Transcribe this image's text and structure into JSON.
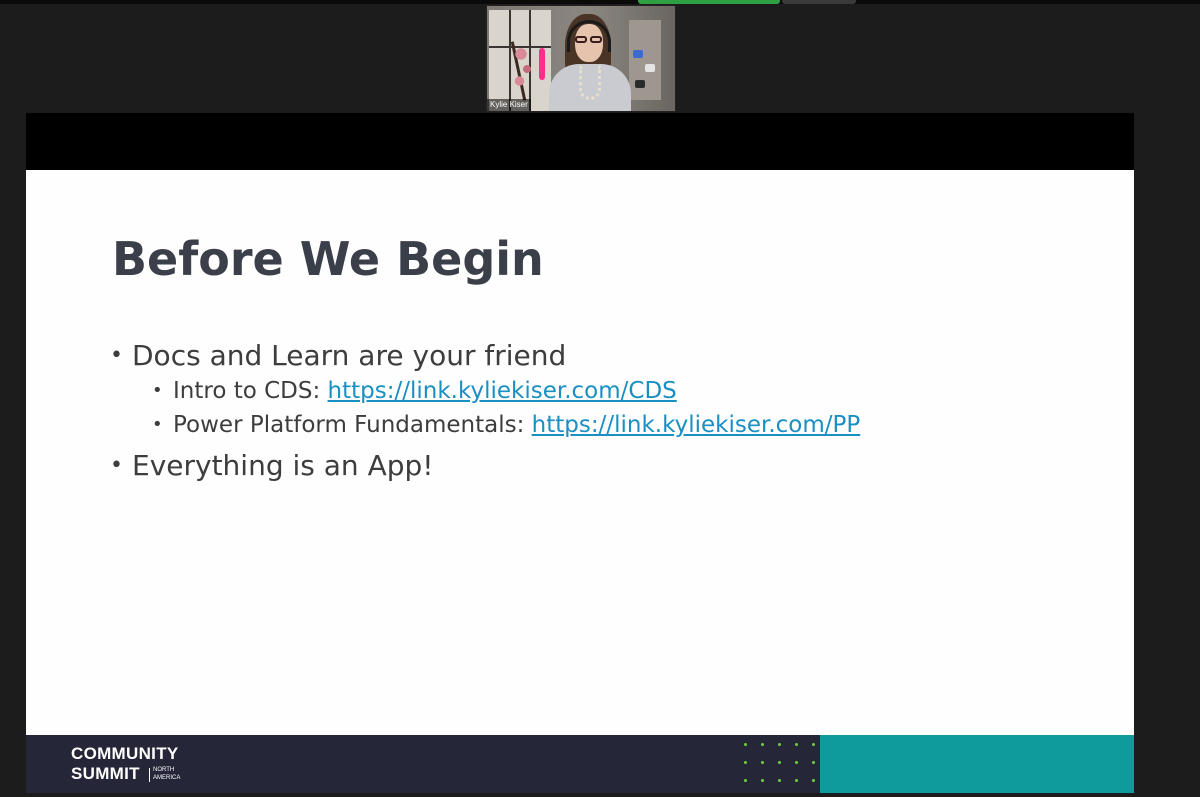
{
  "meeting": {
    "participant_name": "Kylie Kiser"
  },
  "slide": {
    "title": "Before We Begin",
    "bullets": [
      {
        "text": "Docs and Learn are your friend"
      },
      {
        "sub": [
          {
            "label": "Intro to CDS: ",
            "link": "https://link.kyliekiser.com/CDS"
          },
          {
            "label": "Power Platform Fundamentals: ",
            "link": "https://link.kyliekiser.com/PP"
          }
        ]
      },
      {
        "text": "Everything is an App!"
      }
    ],
    "bullet_glyph": "•",
    "footer": {
      "logo_line1": "COMMUNITY",
      "logo_line2": "SUMMIT",
      "region_line1": "NORTH",
      "region_line2": "AMERICA"
    }
  },
  "colors": {
    "title": "#3b3f4a",
    "link": "#1a8fc2",
    "footer_bg": "#252638",
    "footer_accent": "#0f9a9c",
    "dot_accent": "#6fce3b",
    "screen_share_indicator": "#2ea043"
  },
  "icons": {
    "bullet": "bullet-dot-icon"
  }
}
